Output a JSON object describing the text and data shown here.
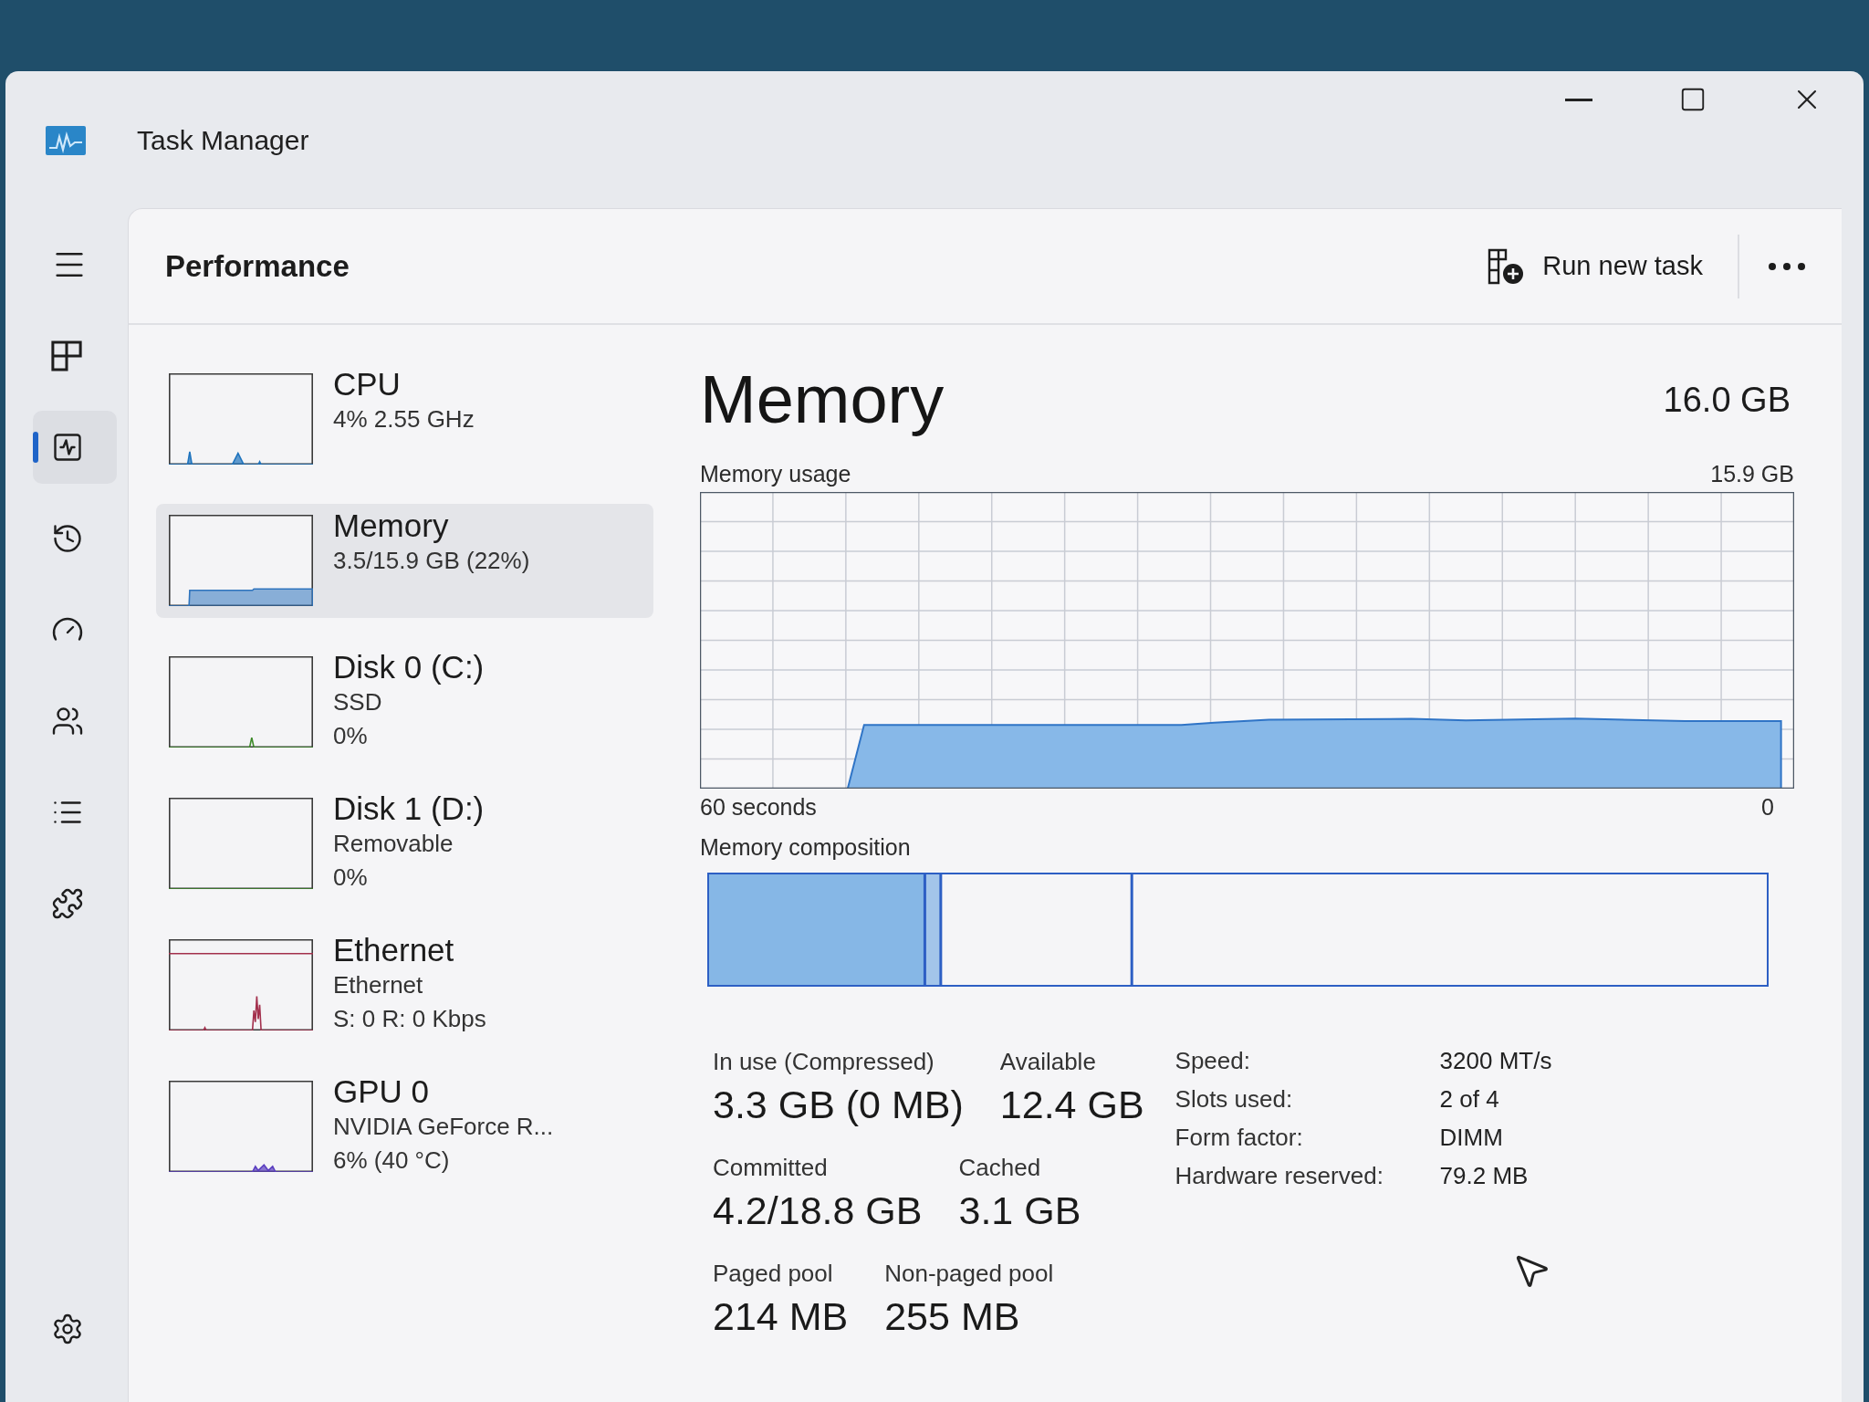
{
  "window": {
    "title": "Task Manager"
  },
  "nav_items": [
    {
      "kind": "processes",
      "selected": false
    },
    {
      "kind": "performance",
      "selected": true
    },
    {
      "kind": "history",
      "selected": false
    },
    {
      "kind": "startup",
      "selected": false
    },
    {
      "kind": "users",
      "selected": false
    },
    {
      "kind": "details",
      "selected": false
    },
    {
      "kind": "services",
      "selected": false
    }
  ],
  "header": {
    "title": "Performance",
    "run_task_button": "Run new task"
  },
  "devices": [
    {
      "kind": "cpu",
      "name": "CPU",
      "lines": [
        "4% 2.55 GHz"
      ],
      "selected": false
    },
    {
      "kind": "memory",
      "name": "Memory",
      "lines": [
        "3.5/15.9 GB (22%)"
      ],
      "selected": true
    },
    {
      "kind": "disk",
      "name": "Disk 0 (C:)",
      "lines": [
        "SSD",
        "0%"
      ],
      "selected": false
    },
    {
      "kind": "disk",
      "name": "Disk 1 (D:)",
      "lines": [
        "Removable",
        "0%"
      ],
      "selected": false
    },
    {
      "kind": "network",
      "name": "Ethernet",
      "lines": [
        "Ethernet",
        "S: 0 R: 0 Kbps"
      ],
      "selected": false
    },
    {
      "kind": "gpu",
      "name": "GPU 0",
      "lines": [
        "NVIDIA GeForce R...",
        "6% (40 °C)"
      ],
      "selected": false
    }
  ],
  "details": {
    "title": "Memory",
    "total": "16.0 GB",
    "usage_label": "Memory usage",
    "usage_max": "15.9 GB",
    "time_span": "60 seconds",
    "time_end": "0",
    "composition_label": "Memory composition",
    "stats": [
      [
        {
          "label": "In use (Compressed)",
          "value": "3.3 GB (0 MB)"
        },
        {
          "label": "Available",
          "value": "12.4 GB"
        }
      ],
      [
        {
          "label": "Committed",
          "value": "4.2/18.8 GB"
        },
        {
          "label": "Cached",
          "value": "3.1 GB"
        }
      ],
      [
        {
          "label": "Paged pool",
          "value": "214 MB"
        },
        {
          "label": "Non-paged pool",
          "value": "255 MB"
        }
      ]
    ],
    "specs": [
      {
        "label": "Speed:",
        "value": "3200 MT/s"
      },
      {
        "label": "Slots used:",
        "value": "2 of 4"
      },
      {
        "label": "Form factor:",
        "value": "DIMM"
      },
      {
        "label": "Hardware reserved:",
        "value": "79.2 MB"
      }
    ]
  }
}
